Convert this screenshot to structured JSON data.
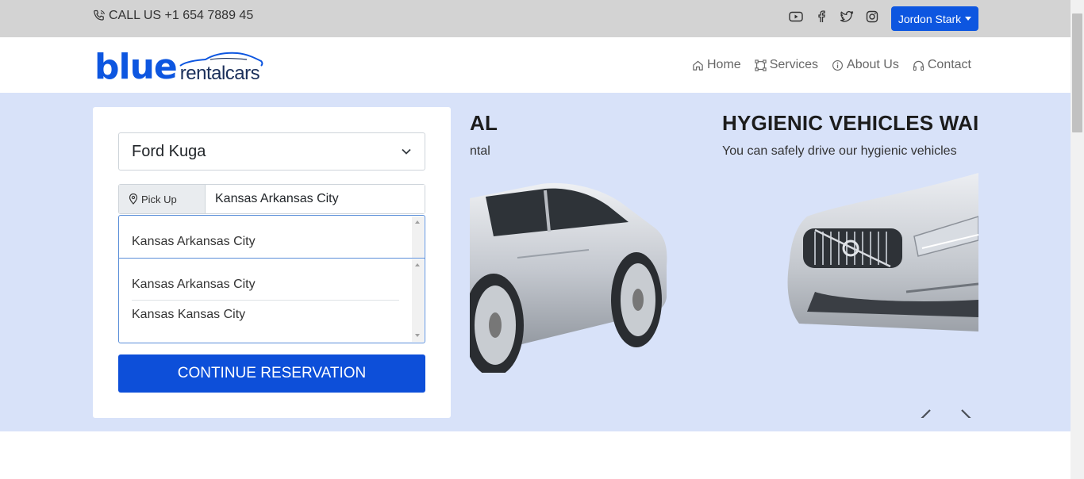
{
  "topbar": {
    "call_text": "CALL US +1 654 7889 45",
    "social_icons": [
      "youtube-icon",
      "facebook-icon",
      "twitter-icon",
      "instagram-icon"
    ],
    "user_name": "Jordon Stark"
  },
  "brand": {
    "blue": "blue",
    "rental": "rentalcars"
  },
  "nav": {
    "items": [
      {
        "label": "Home",
        "icon": "home-icon"
      },
      {
        "label": "Services",
        "icon": "services-icon"
      },
      {
        "label": "About Us",
        "icon": "info-icon"
      },
      {
        "label": "Contact",
        "icon": "headphones-icon"
      }
    ]
  },
  "form": {
    "car_select": "Ford Kuga",
    "pickup_label": "Pick Up",
    "pickup_value": "Kansas Arkansas City",
    "list1": [
      "Kansas Arkansas City"
    ],
    "list2": [
      "Kansas Arkansas City",
      "Kansas Kansas City"
    ],
    "cta": "CONTINUE RESERVATION"
  },
  "slides": [
    {
      "title": "AL",
      "subtitle": "ntal"
    },
    {
      "title": "HYGIENIC VEHICLES WAIT",
      "subtitle": "You can safely drive our hygienic vehicles"
    }
  ],
  "colors": {
    "accent": "#0d56e0",
    "hero_bg": "#d8e2f9",
    "topbar_bg": "#d3d3d3"
  }
}
